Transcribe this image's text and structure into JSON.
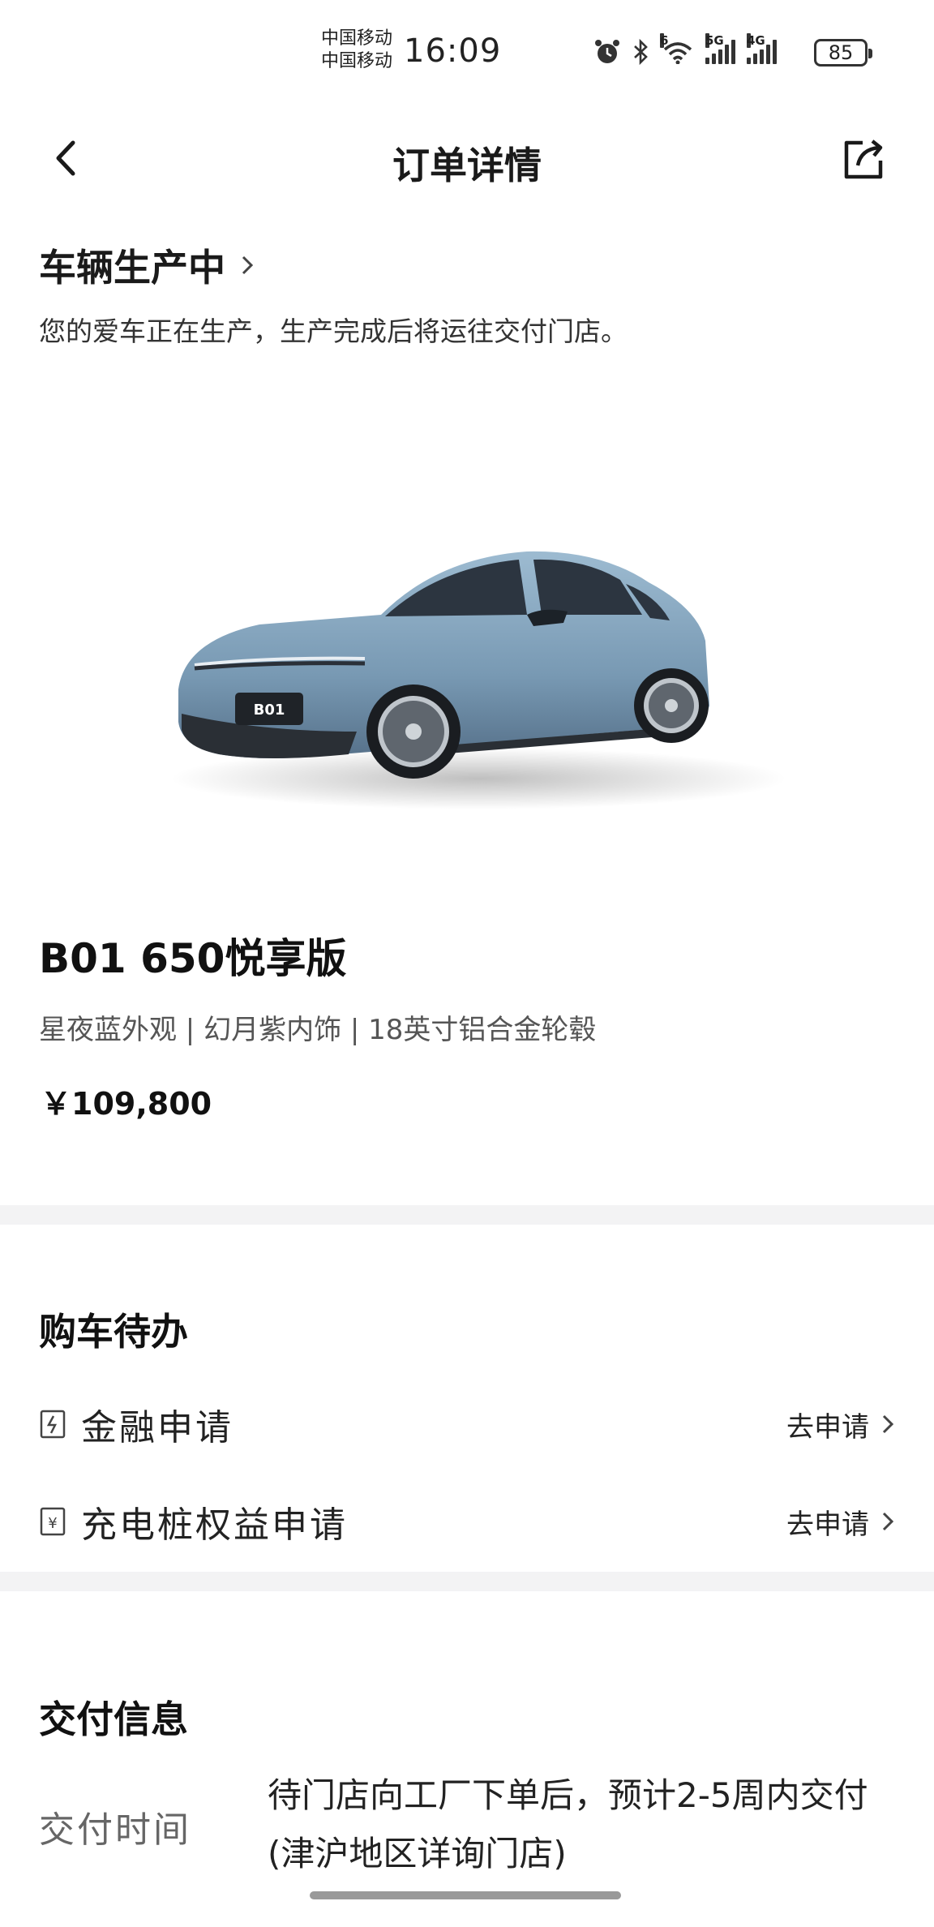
{
  "status_bar": {
    "carrier_1": "中国移动",
    "carrier_2": "中国移动",
    "time": "16:09",
    "signal_label_1": "5G",
    "signal_label_2": "4G",
    "wifi_label": "6",
    "battery": "85"
  },
  "nav": {
    "title": "订单详情"
  },
  "production": {
    "title": "车辆生产中",
    "description": "您的爱车正在生产，生产完成后将运往交付门店。"
  },
  "vehicle": {
    "plate_text": "B01",
    "model_name": "B01 650悦享版",
    "config": "星夜蓝外观 | 幻月紫内饰 | 18英寸铝合金轮毂",
    "price": "￥109,800",
    "body_color": "#7fa3bf"
  },
  "todo": {
    "title": "购车待办",
    "items": [
      {
        "label": "金融申请",
        "action": "去申请",
        "icon": "finance-doc-icon"
      },
      {
        "label": "充电桩权益申请",
        "action": "去申请",
        "icon": "yuan-doc-icon"
      }
    ]
  },
  "delivery": {
    "title": "交付信息",
    "time_label": "交付时间",
    "time_value": "待门店向工厂下单后，预计2-5周内交付(津沪地区详询门店)"
  }
}
